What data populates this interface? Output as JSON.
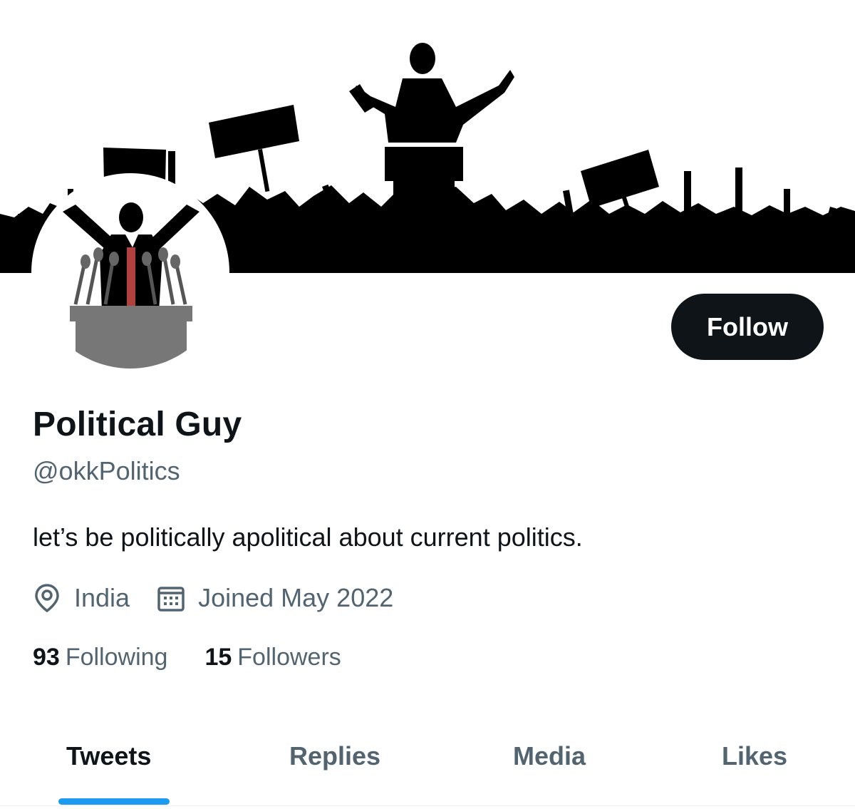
{
  "profile": {
    "display_name": "Political Guy",
    "handle": "@okkPolitics",
    "bio": "let’s be politically apolitical about current politics.",
    "location": "India",
    "joined": "Joined May 2022",
    "location_icon": "location-pin-icon",
    "calendar_icon": "calendar-icon"
  },
  "follow_button": {
    "label": "Follow"
  },
  "stats": {
    "following_count": "93",
    "following_label": "Following",
    "followers_count": "15",
    "followers_label": "Followers"
  },
  "tabs": [
    {
      "label": "Tweets",
      "active": true
    },
    {
      "label": "Replies",
      "active": false
    },
    {
      "label": "Media",
      "active": false
    },
    {
      "label": "Likes",
      "active": false
    }
  ],
  "colors": {
    "accent": "#1d9bf0",
    "text_primary": "#0f1419",
    "text_secondary": "#536471",
    "button_bg": "#0f1419"
  }
}
